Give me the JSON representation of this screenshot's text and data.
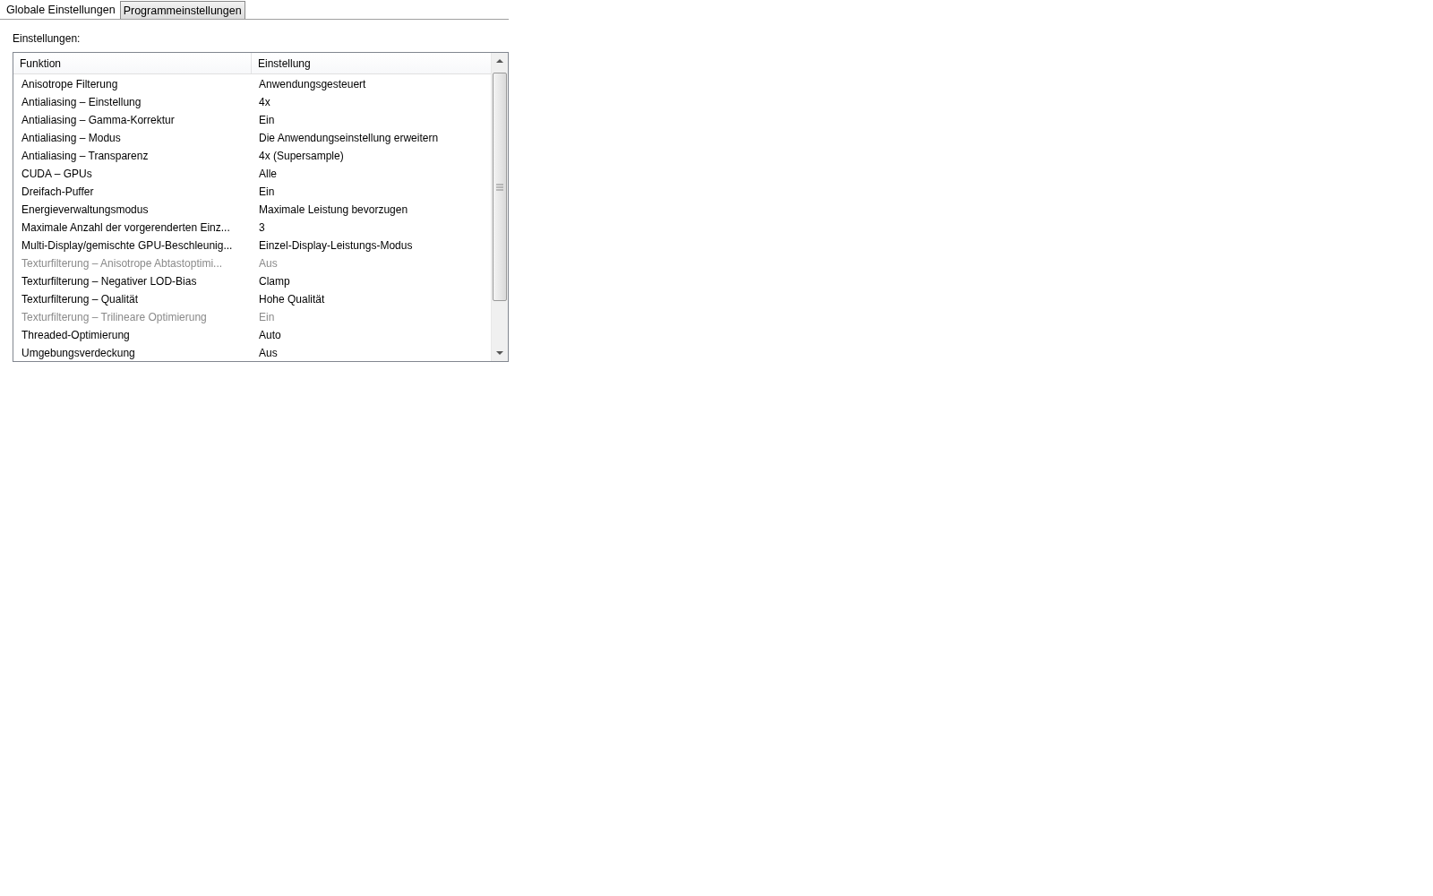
{
  "tabs": [
    {
      "label": "Globale Einstellungen",
      "selected": true
    },
    {
      "label": "Programmeinstellungen",
      "selected": false
    }
  ],
  "settings_label": "Einstellungen:",
  "table": {
    "columns": [
      "Funktion",
      "Einstellung"
    ],
    "rows": [
      {
        "function": "Anisotrope Filterung",
        "setting": "Anwendungsgesteuert",
        "disabled": false
      },
      {
        "function": "Antialiasing – Einstellung",
        "setting": "4x",
        "disabled": false
      },
      {
        "function": "Antialiasing – Gamma-Korrektur",
        "setting": "Ein",
        "disabled": false
      },
      {
        "function": "Antialiasing – Modus",
        "setting": "Die Anwendungseinstellung erweitern",
        "disabled": false
      },
      {
        "function": "Antialiasing – Transparenz",
        "setting": "4x (Supersample)",
        "disabled": false
      },
      {
        "function": "CUDA – GPUs",
        "setting": "Alle",
        "disabled": false
      },
      {
        "function": "Dreifach-Puffer",
        "setting": "Ein",
        "disabled": false
      },
      {
        "function": "Energieverwaltungsmodus",
        "setting": "Maximale Leistung bevorzugen",
        "disabled": false
      },
      {
        "function": "Maximale Anzahl der vorgerenderten Einz...",
        "setting": "3",
        "disabled": false
      },
      {
        "function": "Multi-Display/gemischte GPU-Beschleunig...",
        "setting": "Einzel-Display-Leistungs-Modus",
        "disabled": false
      },
      {
        "function": "Texturfilterung – Anisotrope Abtastoptimi...",
        "setting": "Aus",
        "disabled": true
      },
      {
        "function": "Texturfilterung – Negativer LOD-Bias",
        "setting": "Clamp",
        "disabled": false
      },
      {
        "function": "Texturfilterung – Qualität",
        "setting": "Hohe Qualität",
        "disabled": false
      },
      {
        "function": "Texturfilterung – Trilineare Optimierung",
        "setting": "Ein",
        "disabled": true
      },
      {
        "function": "Threaded-Optimierung",
        "setting": "Auto",
        "disabled": false
      },
      {
        "function": "Umgebungsverdeckung",
        "setting": "Aus",
        "disabled": false
      }
    ]
  }
}
